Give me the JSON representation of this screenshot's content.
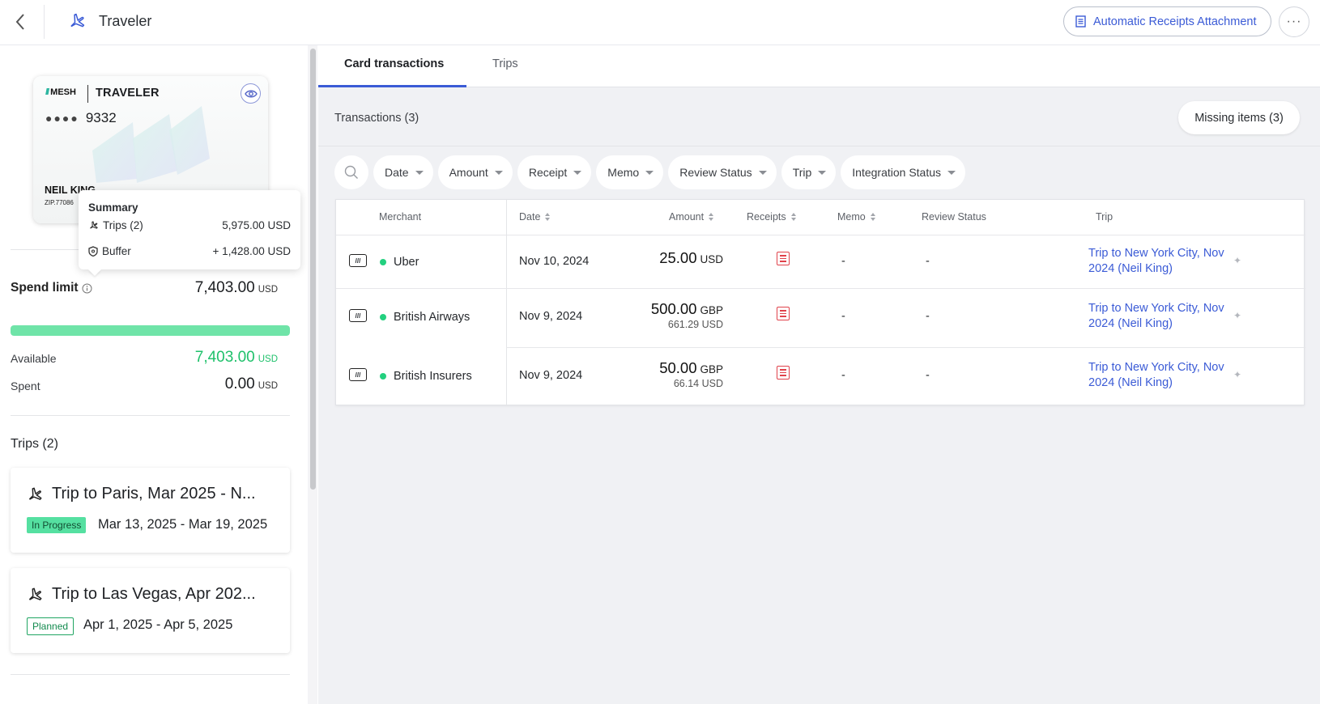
{
  "header": {
    "title": "Traveler",
    "auto_receipts_label": "Automatic Receipts Attachment",
    "more_label": "···"
  },
  "card": {
    "logo": "MESH",
    "brand": "TRAVELER",
    "masked": "●●●●",
    "last4": "9332",
    "name": "NEIL KING",
    "zip": "ZIP.77086"
  },
  "summary": {
    "title": "Summary",
    "trips_label": "Trips (2)",
    "trips_value": "5,975.00 USD",
    "buffer_label": "Buffer",
    "buffer_value": "+ 1,428.00 USD"
  },
  "spend": {
    "label": "Spend limit",
    "limit": "7,403.00",
    "currency": "USD",
    "progress": 1.0,
    "available_label": "Available",
    "available": "7,403.00",
    "spent_label": "Spent",
    "spent": "0.00"
  },
  "trips": {
    "title": "Trips (2)",
    "items": [
      {
        "title": "Trip to Paris, Mar 2025 - N...",
        "status": "In Progress",
        "dates": "Mar 13, 2025 - Mar 19, 2025"
      },
      {
        "title": "Trip to Las Vegas, Apr 202...",
        "status": "Planned",
        "dates": "Apr 1, 2025 - Apr 5, 2025"
      }
    ]
  },
  "tabs": [
    {
      "label": "Card transactions",
      "active": true
    },
    {
      "label": "Trips",
      "active": false
    }
  ],
  "transactions": {
    "title": "Transactions (3)",
    "missing_label": "Missing items (3)",
    "filters": [
      "Date",
      "Amount",
      "Receipt",
      "Memo",
      "Review Status",
      "Trip",
      "Integration Status"
    ],
    "columns": {
      "merchant": "Merchant",
      "date": "Date",
      "amount": "Amount",
      "receipts": "Receipts",
      "memo": "Memo",
      "review_status": "Review Status",
      "trip": "Trip"
    },
    "rows": [
      {
        "merchant": "Uber",
        "date": "Nov 10, 2024",
        "amount": "25.00",
        "currency": "USD",
        "sub_amount": "",
        "memo": "-",
        "review": "-",
        "trip": "Trip to New York City, Nov 2024 (Neil King)"
      },
      {
        "merchant": "British Airways",
        "date": "Nov 9, 2024",
        "amount": "500.00",
        "currency": "GBP",
        "sub_amount": "661.29 USD",
        "memo": "-",
        "review": "-",
        "trip": "Trip to New York City, Nov 2024 (Neil King)"
      },
      {
        "merchant": "British Insurers",
        "date": "Nov 9, 2024",
        "amount": "50.00",
        "currency": "GBP",
        "sub_amount": "66.14 USD",
        "memo": "-",
        "review": "-",
        "trip": "Trip to New York City, Nov 2024 (Neil King)"
      }
    ]
  },
  "colors": {
    "accent": "#3b5bd6",
    "available_green": "#1fc16b",
    "status_dot": "#23d07f",
    "receipt_red": "#e0424b"
  },
  "icons": {
    "back": "chevron-left-icon",
    "traveler": "airplane-icon",
    "receipt": "receipt-icon",
    "eye": "eye-icon",
    "info": "info-icon",
    "shield": "shield-icon",
    "search": "search-icon",
    "card": "card-icon",
    "sparkle": "sparkle-icon"
  }
}
